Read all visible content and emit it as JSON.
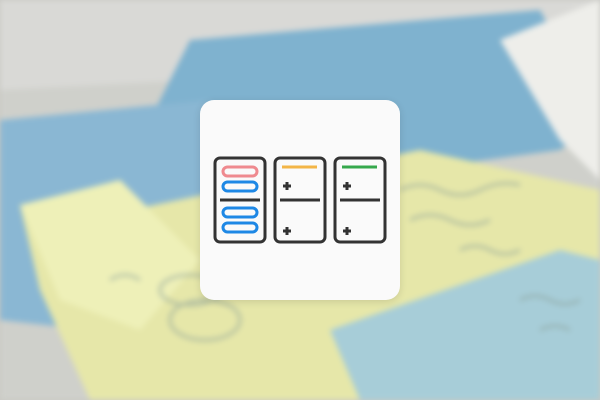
{
  "background": {
    "description_icon": "sticky-notes-photo-background",
    "handwriting": []
  },
  "icon": {
    "name": "kanban-board-icon",
    "columns": [
      {
        "name": "column-1",
        "cards": 4,
        "accent_color": "#ef8a8f",
        "card_colors": [
          "#ef8a8f",
          "#1e88e5",
          "#1e88e5",
          "#1e88e5"
        ]
      },
      {
        "name": "column-2",
        "accent_color": "#f3b547",
        "add_icon": "plus-icon"
      },
      {
        "name": "column-3",
        "accent_color": "#35a84c",
        "add_icon": "plus-icon"
      }
    ],
    "outline_color": "#333333",
    "card_background": "#fafafa"
  }
}
